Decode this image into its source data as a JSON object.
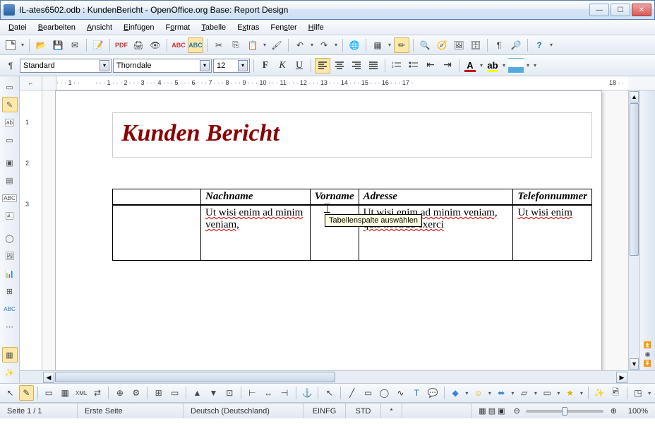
{
  "window": {
    "title": "IL-ates6502.odb : KundenBericht - OpenOffice.org Base: Report Design"
  },
  "menu": [
    "Datei",
    "Bearbeiten",
    "Ansicht",
    "Einfügen",
    "Format",
    "Tabelle",
    "Extras",
    "Fenster",
    "Hilfe"
  ],
  "format": {
    "style": "Standard",
    "font": "Thorndale",
    "size": "12"
  },
  "report": {
    "title": "Kunden Bericht",
    "headers": [
      "Nachname",
      "Vorname",
      "Adresse",
      "Telefonnummer"
    ],
    "row": {
      "nachname": "Ut wisi enim ad minim veniam,",
      "vorname": "",
      "adresse": "Ut wisi enim ad minim veniam, quis nostrud exerci",
      "telefon": "Ut wisi enim"
    }
  },
  "tooltip": "Tabellenspalte auswählen",
  "ruler_h": [
    "1",
    "1",
    "2",
    "3",
    "4",
    "5",
    "6",
    "7",
    "8",
    "9",
    "10",
    "11",
    "12",
    "13",
    "14",
    "15",
    "16",
    "17",
    "18"
  ],
  "ruler_v": [
    "1",
    "2",
    "3"
  ],
  "status": {
    "page": "Seite 1 / 1",
    "template": "Erste Seite",
    "lang": "Deutsch (Deutschland)",
    "insert": "EINFG",
    "sel": "STD",
    "mod": "*",
    "zoom": "100%"
  },
  "colors": {
    "title": "#8b0000",
    "highlight": "#ffff00",
    "font_color": "#cc0000"
  }
}
